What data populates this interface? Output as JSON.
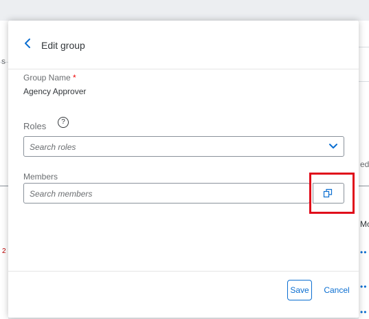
{
  "background": {
    "fragment_left_s": "s",
    "fragment_left_2": "2",
    "fragment_right_ed": "ed",
    "fragment_right_mo": "Mo",
    "dots": "••"
  },
  "dialog": {
    "title": "Edit group",
    "back_icon": "chevron-left-icon",
    "group_name": {
      "label": "Group Name",
      "required_mark": "*",
      "value": "Agency Approver"
    },
    "roles": {
      "label": "Roles",
      "help_icon": "question-circle-icon",
      "help_glyph": "?",
      "placeholder": "Search roles"
    },
    "members": {
      "label": "Members",
      "placeholder": "Search members",
      "value_help_icon": "value-help-icon"
    },
    "footer": {
      "save_label": "Save",
      "cancel_label": "Cancel"
    }
  },
  "colors": {
    "accent": "#0a6ed1",
    "highlight": "#e00a1a",
    "required": "#ee0000"
  }
}
